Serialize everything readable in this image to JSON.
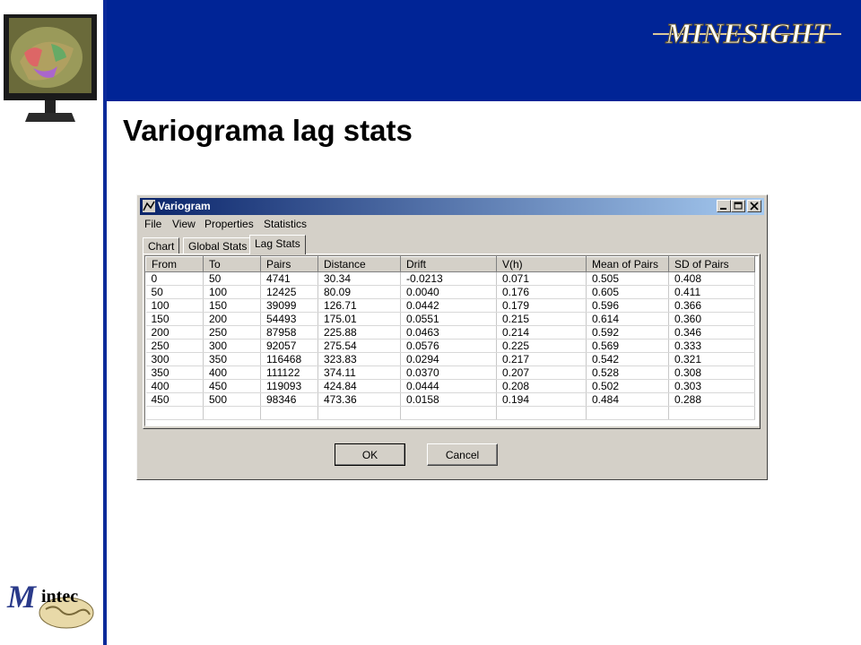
{
  "slide": {
    "title": "Variograma lag stats",
    "brand_logo_text": "MineSight",
    "company_logo_text": "Mintec",
    "colors": {
      "band": "#002496",
      "titlebar_start": "#0a246a",
      "titlebar_end": "#a6caf0",
      "dialog_face": "#d4d0c8"
    }
  },
  "window": {
    "title": "Variogram",
    "icon": "variogram-app-icon",
    "controls": [
      "minimize-icon",
      "maximize-icon",
      "close-icon"
    ]
  },
  "menu": {
    "file": "File",
    "view": "View",
    "properties": "Properties",
    "statistics": "Statistics"
  },
  "tabs": {
    "chart": "Chart",
    "global": "Global Stats",
    "lag": "Lag Stats",
    "active": "Lag Stats"
  },
  "table": {
    "columns": [
      "From",
      "To",
      "Pairs",
      "Distance",
      "Drift",
      "V(h)",
      "Mean of Pairs",
      "SD of Pairs"
    ],
    "rows": [
      [
        "0",
        "50",
        "4741",
        "30.34",
        "-0.0213",
        "0.071",
        "0.505",
        "0.408"
      ],
      [
        "50",
        "100",
        "12425",
        "80.09",
        "0.0040",
        "0.176",
        "0.605",
        "0.411"
      ],
      [
        "100",
        "150",
        "39099",
        "126.71",
        "0.0442",
        "0.179",
        "0.596",
        "0.366"
      ],
      [
        "150",
        "200",
        "54493",
        "175.01",
        "0.0551",
        "0.215",
        "0.614",
        "0.360"
      ],
      [
        "200",
        "250",
        "87958",
        "225.88",
        "0.0463",
        "0.214",
        "0.592",
        "0.346"
      ],
      [
        "250",
        "300",
        "92057",
        "275.54",
        "0.0576",
        "0.225",
        "0.569",
        "0.333"
      ],
      [
        "300",
        "350",
        "116468",
        "323.83",
        "0.0294",
        "0.217",
        "0.542",
        "0.321"
      ],
      [
        "350",
        "400",
        "111122",
        "374.11",
        "0.0370",
        "0.207",
        "0.528",
        "0.308"
      ],
      [
        "400",
        "450",
        "119093",
        "424.84",
        "0.0444",
        "0.208",
        "0.502",
        "0.303"
      ],
      [
        "450",
        "500",
        "98346",
        "473.36",
        "0.0158",
        "0.194",
        "0.484",
        "0.288"
      ],
      [
        "",
        "",
        "",
        "",
        "",
        "",
        "",
        ""
      ]
    ]
  },
  "buttons": {
    "ok": "OK",
    "cancel": "Cancel"
  }
}
